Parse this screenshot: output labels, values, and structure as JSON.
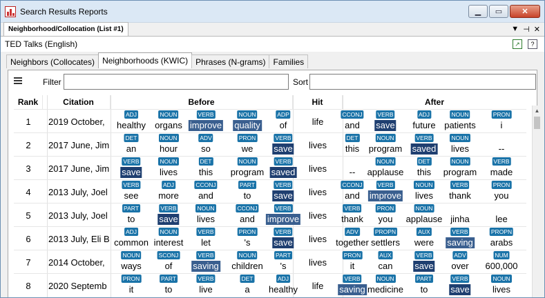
{
  "window": {
    "title": "Search Results Reports",
    "minimize": "▁",
    "maximize": "▭",
    "close": "✕"
  },
  "doctab": {
    "label": "Neighborhood/Collocation (List #1)",
    "menu": "▼",
    "pin": "⊣",
    "close": "✕"
  },
  "corpus": {
    "name": "TED Talks (English)",
    "export_icon": "export-icon",
    "help_icon": "help-icon"
  },
  "tabs": [
    {
      "label": "Neighbors (Collocates)",
      "active": false
    },
    {
      "label": "Neighborhoods (KWIC)",
      "active": true
    },
    {
      "label": "Phrases (N-grams)",
      "active": false
    },
    {
      "label": "Families",
      "active": false
    }
  ],
  "filter": {
    "label": "Filter",
    "value": ""
  },
  "sort": {
    "label": "Sort",
    "value": ""
  },
  "columns": {
    "rank": "Rank",
    "citation": "Citation",
    "before": "Before",
    "hit": "Hit",
    "after": "After"
  },
  "rows": [
    {
      "rank": "1",
      "citation": "2019 October,",
      "hit": "life",
      "before": [
        [
          "ADJ",
          "healthy",
          ""
        ],
        [
          "NOUN",
          "organs",
          ""
        ],
        [
          "VERB",
          "improve",
          "hl"
        ],
        [
          "NOUN",
          "quality",
          "hl"
        ],
        [
          "ADP",
          "of",
          ""
        ]
      ],
      "after": [
        [
          "CCONJ",
          "and",
          ""
        ],
        [
          "VERB",
          "save",
          "hl2"
        ],
        [
          "ADJ",
          "future",
          ""
        ],
        [
          "NOUN",
          "patients",
          ""
        ],
        [
          "PRON",
          "i",
          ""
        ]
      ]
    },
    {
      "rank": "2",
      "citation": "2017 June, Jim",
      "hit": "lives",
      "before": [
        [
          "DET",
          "an",
          ""
        ],
        [
          "NOUN",
          "hour",
          ""
        ],
        [
          "ADV",
          "so",
          ""
        ],
        [
          "PRON",
          "we",
          ""
        ],
        [
          "VERB",
          "save",
          "hl2"
        ]
      ],
      "after": [
        [
          "DET",
          "this",
          ""
        ],
        [
          "NOUN",
          "program",
          ""
        ],
        [
          "VERB",
          "saved",
          "hl2"
        ],
        [
          "NOUN",
          "lives",
          ""
        ],
        [
          "",
          "--",
          ""
        ]
      ]
    },
    {
      "rank": "3",
      "citation": "2017 June, Jim",
      "hit": "lives",
      "before": [
        [
          "VERB",
          "save",
          "hl2"
        ],
        [
          "NOUN",
          "lives",
          ""
        ],
        [
          "DET",
          "this",
          ""
        ],
        [
          "NOUN",
          "program",
          ""
        ],
        [
          "VERB",
          "saved",
          "hl2"
        ]
      ],
      "after": [
        [
          "",
          "--",
          ""
        ],
        [
          "NOUN",
          "applause",
          ""
        ],
        [
          "DET",
          "this",
          ""
        ],
        [
          "NOUN",
          "program",
          ""
        ],
        [
          "VERB",
          "made",
          ""
        ]
      ]
    },
    {
      "rank": "4",
      "citation": "2013 July, Joel",
      "hit": "lives",
      "before": [
        [
          "VERB",
          "see",
          ""
        ],
        [
          "ADJ",
          "more",
          ""
        ],
        [
          "CCONJ",
          "and",
          ""
        ],
        [
          "PART",
          "to",
          ""
        ],
        [
          "VERB",
          "save",
          "hl2"
        ]
      ],
      "after": [
        [
          "CCONJ",
          "and",
          ""
        ],
        [
          "VERB",
          "improve",
          "hl"
        ],
        [
          "NOUN",
          "lives",
          ""
        ],
        [
          "VERB",
          "thank",
          ""
        ],
        [
          "PRON",
          "you",
          ""
        ]
      ]
    },
    {
      "rank": "5",
      "citation": "2013 July, Joel",
      "hit": "lives",
      "before": [
        [
          "PART",
          "to",
          ""
        ],
        [
          "VERB",
          "save",
          "hl2"
        ],
        [
          "NOUN",
          "lives",
          ""
        ],
        [
          "CCONJ",
          "and",
          ""
        ],
        [
          "VERB",
          "improve",
          "hl"
        ]
      ],
      "after": [
        [
          "VERB",
          "thank",
          ""
        ],
        [
          "PRON",
          "you",
          ""
        ],
        [
          "NOUN",
          "applause",
          ""
        ],
        [
          "",
          "jinha",
          ""
        ],
        [
          "",
          "lee",
          ""
        ]
      ]
    },
    {
      "rank": "6",
      "citation": "2013 July, Eli B",
      "hit": "lives",
      "before": [
        [
          "ADJ",
          "common",
          ""
        ],
        [
          "NOUN",
          "interest",
          ""
        ],
        [
          "VERB",
          "let",
          ""
        ],
        [
          "PRON",
          "'s",
          ""
        ],
        [
          "VERB",
          "save",
          "hl2"
        ]
      ],
      "after": [
        [
          "ADV",
          "together",
          ""
        ],
        [
          "PROPN",
          "settlers",
          ""
        ],
        [
          "AUX",
          "were",
          ""
        ],
        [
          "VERB",
          "saving",
          "hl"
        ],
        [
          "PROPN",
          "arabs",
          ""
        ]
      ]
    },
    {
      "rank": "7",
      "citation": "2014 October,",
      "hit": "lives",
      "before": [
        [
          "NOUN",
          "ways",
          ""
        ],
        [
          "SCONJ",
          "of",
          ""
        ],
        [
          "VERB",
          "saving",
          "hl"
        ],
        [
          "NOUN",
          "children",
          ""
        ],
        [
          "PART",
          "'s",
          ""
        ]
      ],
      "after": [
        [
          "PRON",
          "it",
          ""
        ],
        [
          "AUX",
          "can",
          ""
        ],
        [
          "VERB",
          "save",
          "hl2"
        ],
        [
          "ADV",
          "over",
          ""
        ],
        [
          "NUM",
          "600,000",
          ""
        ]
      ]
    },
    {
      "rank": "8",
      "citation": "2020 Septemb",
      "hit": "life",
      "before": [
        [
          "PRON",
          "it",
          ""
        ],
        [
          "PART",
          "to",
          ""
        ],
        [
          "VERB",
          "live",
          ""
        ],
        [
          "DET",
          "a",
          ""
        ],
        [
          "ADJ",
          "healthy",
          ""
        ]
      ],
      "after": [
        [
          "VERB",
          "saving",
          "hl"
        ],
        [
          "NOUN",
          "medicine",
          ""
        ],
        [
          "PART",
          "to",
          ""
        ],
        [
          "VERB",
          "save",
          "hl2"
        ],
        [
          "NOUN",
          "lives",
          ""
        ]
      ]
    }
  ]
}
